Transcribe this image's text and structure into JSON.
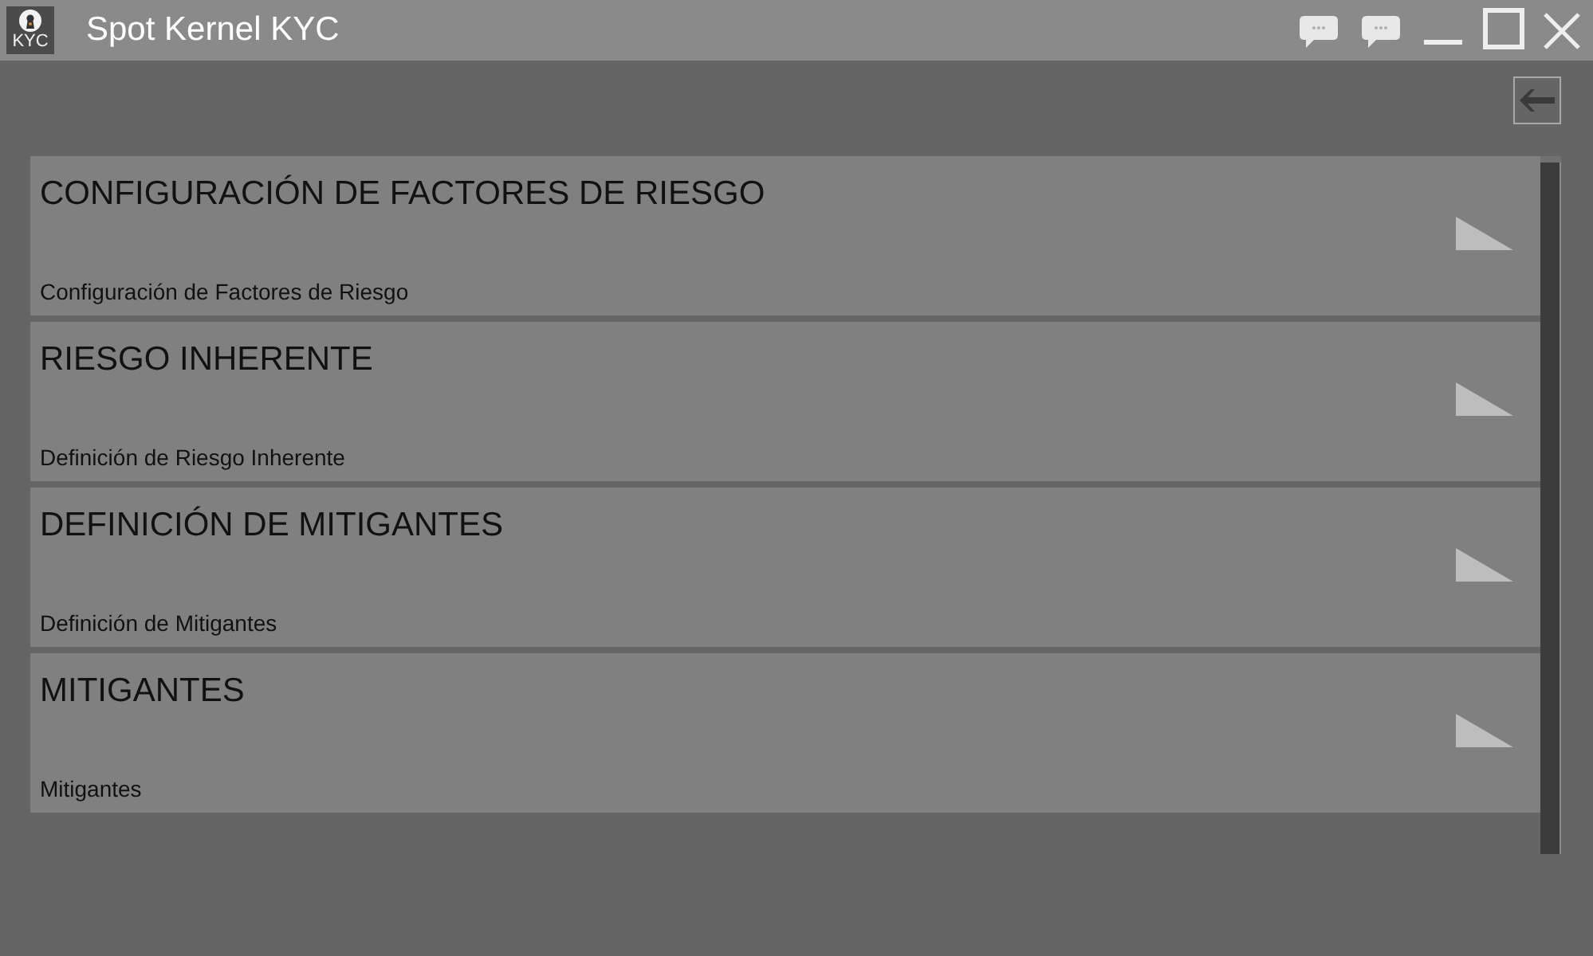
{
  "window": {
    "title": "Spot Kernel KYC",
    "logo_text": "KYC"
  },
  "tiles": [
    {
      "title": "CONFIGURACIÓN DE FACTORES DE RIESGO",
      "subtitle": "Configuración de Factores de Riesgo"
    },
    {
      "title": "RIESGO INHERENTE",
      "subtitle": "Definición de Riesgo Inherente"
    },
    {
      "title": "DEFINICIÓN DE MITIGANTES",
      "subtitle": "Definición de Mitigantes"
    },
    {
      "title": "MITIGANTES",
      "subtitle": "Mitigantes"
    }
  ]
}
